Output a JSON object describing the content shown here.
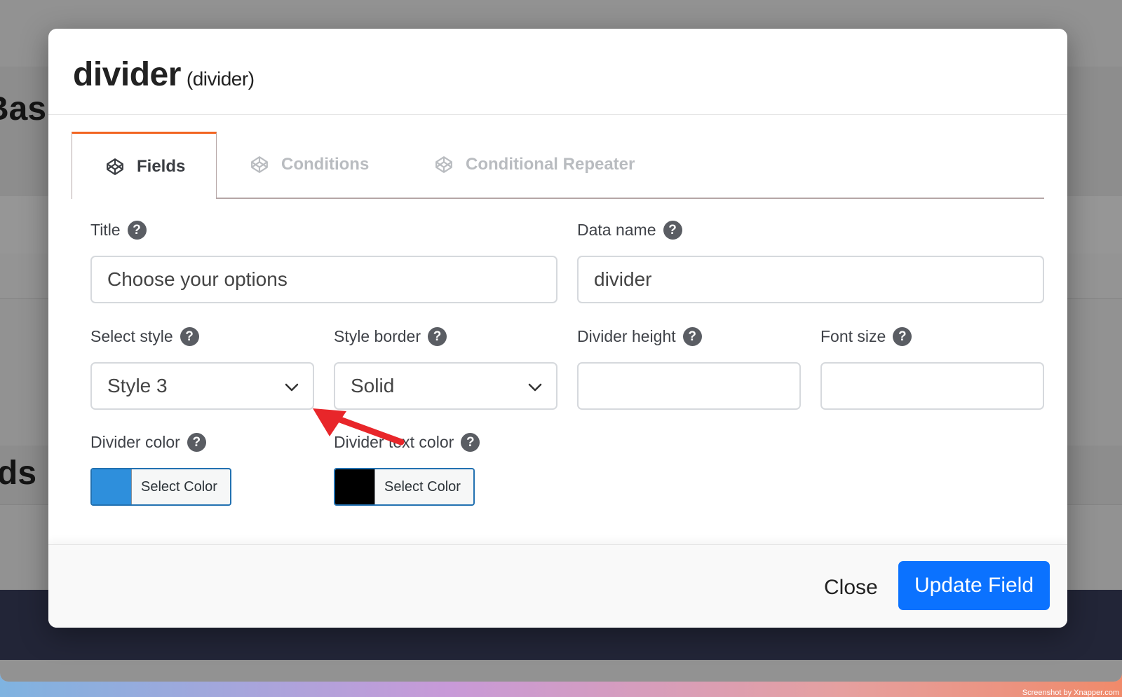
{
  "background": {
    "heading_1": "Bas",
    "heading_2": "ds",
    "credit": "Screenshot by Xnapper.com"
  },
  "modal": {
    "title": "divider",
    "subtitle": "(divider)",
    "tabs": [
      {
        "label": "Fields",
        "icon": "codepen-icon",
        "active": true
      },
      {
        "label": "Conditions",
        "icon": "codepen-icon",
        "active": false
      },
      {
        "label": "Conditional Repeater",
        "icon": "codepen-icon",
        "active": false
      }
    ],
    "fields": {
      "title_label": "Title",
      "title_value": "Choose your options",
      "data_name_label": "Data name",
      "data_name_value": "divider",
      "select_style_label": "Select style",
      "select_style_value": "Style 3",
      "style_border_label": "Style border",
      "style_border_value": "Solid",
      "divider_height_label": "Divider height",
      "divider_height_value": "",
      "font_size_label": "Font size",
      "font_size_value": "",
      "divider_color_label": "Divider color",
      "divider_color_value": "#2e8fdc",
      "divider_text_color_label": "Divider text color",
      "divider_text_color_value": "#000000",
      "select_color_label": "Select Color"
    },
    "footer": {
      "close_label": "Close",
      "update_label": "Update Field"
    }
  },
  "colors": {
    "accent_tab": "#f26522",
    "primary_button": "#0b72ff",
    "annotation_arrow": "#e8262a"
  }
}
